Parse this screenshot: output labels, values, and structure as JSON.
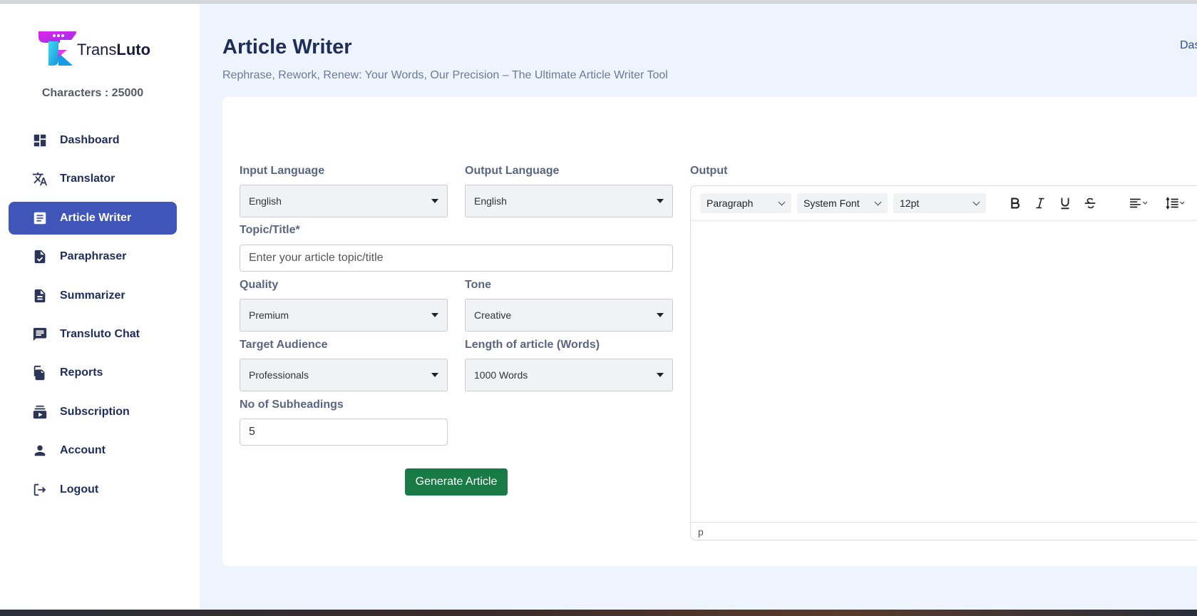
{
  "app": {
    "logo_prefix": "Trans",
    "logo_suffix": "Luto",
    "characters_label": "Characters : 25000"
  },
  "sidebar": {
    "items": [
      {
        "label": "Dashboard",
        "icon": "dashboard-icon",
        "active": false
      },
      {
        "label": "Translator",
        "icon": "translate-icon",
        "active": false
      },
      {
        "label": "Article Writer",
        "icon": "article-icon",
        "active": true
      },
      {
        "label": "Paraphraser",
        "icon": "document-check-icon",
        "active": false
      },
      {
        "label": "Summarizer",
        "icon": "document-lines-icon",
        "active": false
      },
      {
        "label": "Transluto Chat",
        "icon": "chat-icon",
        "active": false
      },
      {
        "label": "Reports",
        "icon": "reports-icon",
        "active": false
      },
      {
        "label": "Subscription",
        "icon": "subscription-icon",
        "active": false
      },
      {
        "label": "Account",
        "icon": "user-icon",
        "active": false
      },
      {
        "label": "Logout",
        "icon": "logout-icon",
        "active": false
      }
    ]
  },
  "header": {
    "title": "Article Writer",
    "subtitle": "Rephrase, Rework, Renew: Your Words, Our Precision – The Ultimate Article Writer Tool",
    "topright_link": "Dashboard"
  },
  "form": {
    "input_language": {
      "label": "Input Language",
      "value": "English"
    },
    "output_language": {
      "label": "Output Language",
      "value": "English"
    },
    "topic": {
      "label": "Topic/Title*",
      "placeholder": "Enter your article topic/title",
      "value": ""
    },
    "quality": {
      "label": "Quality",
      "value": "Premium"
    },
    "tone": {
      "label": "Tone",
      "value": "Creative"
    },
    "audience": {
      "label": "Target Audience",
      "value": "Professionals"
    },
    "length": {
      "label": "Length of article (Words)",
      "value": "1000 Words"
    },
    "subheadings": {
      "label": "No of Subheadings",
      "value": "5"
    },
    "generate_button": "Generate Article"
  },
  "output": {
    "label": "Output",
    "block_format": "Paragraph",
    "font_family": "System Font",
    "font_size": "12pt",
    "status_path": "p"
  },
  "colors": {
    "accent": "#3f55b8",
    "generate": "#1a7a45",
    "page_bg": "#eef4fd",
    "logo_magenta": "#e025e8",
    "logo_cyan": "#1ec8e6"
  }
}
